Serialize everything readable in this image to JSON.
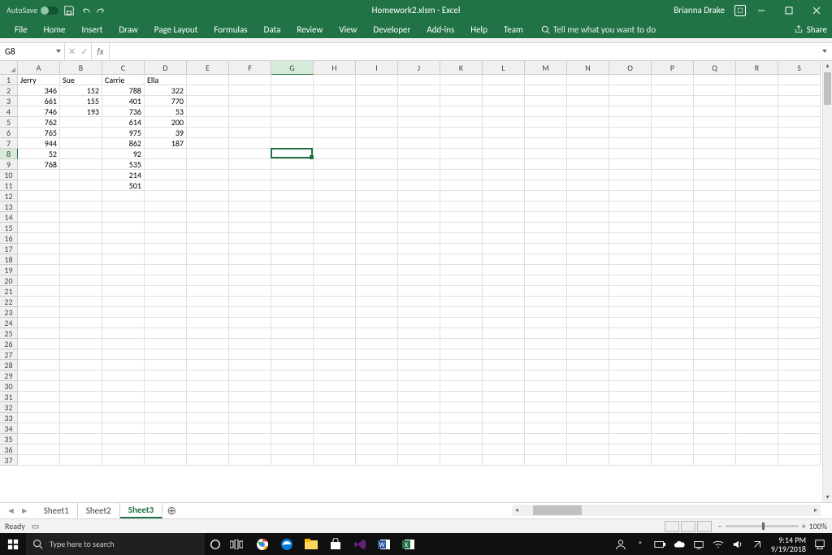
{
  "titlebar": {
    "autosave": "AutoSave",
    "title": "Homework2.xlsm - Excel",
    "user": "Brianna Drake"
  },
  "ribbon": {
    "tabs": [
      "File",
      "Home",
      "Insert",
      "Draw",
      "Page Layout",
      "Formulas",
      "Data",
      "Review",
      "View",
      "Developer",
      "Add-ins",
      "Help",
      "Team"
    ],
    "tellme": "Tell me what you want to do",
    "share": "Share"
  },
  "formula_bar": {
    "namebox": "G8",
    "cancel": "✕",
    "enter": "✓",
    "fx": "fx",
    "value": ""
  },
  "columns": [
    "A",
    "B",
    "C",
    "D",
    "E",
    "F",
    "G",
    "H",
    "I",
    "J",
    "K",
    "L",
    "M",
    "N",
    "O",
    "P",
    "Q",
    "R",
    "S"
  ],
  "row_count": 37,
  "active_cell": {
    "col": 6,
    "row": 7
  },
  "headers_row": [
    "Jerry",
    "Sue",
    "Carrie",
    "Ella"
  ],
  "chart_data": {
    "type": "table",
    "columns": [
      "Jerry",
      "Sue",
      "Carrie",
      "Ella"
    ],
    "rows": [
      [
        346,
        152,
        788,
        322
      ],
      [
        661,
        155,
        401,
        770
      ],
      [
        746,
        193,
        736,
        53
      ],
      [
        762,
        null,
        614,
        200
      ],
      [
        765,
        null,
        975,
        39
      ],
      [
        944,
        null,
        862,
        187
      ],
      [
        52,
        null,
        92,
        null
      ],
      [
        768,
        null,
        535,
        null
      ],
      [
        null,
        null,
        214,
        null
      ],
      [
        null,
        null,
        501,
        null
      ]
    ]
  },
  "sheets": {
    "nav_prev": "◄",
    "nav_next": "►",
    "tabs": [
      "Sheet1",
      "Sheet2",
      "Sheet3"
    ],
    "active": 2,
    "add": "⊕"
  },
  "statusbar": {
    "ready": "Ready",
    "zoom_minus": "−",
    "zoom_plus": "+",
    "zoom": "100%"
  },
  "taskbar": {
    "search_placeholder": "Type here to search",
    "time": "9:14 PM",
    "date": "9/19/2018"
  }
}
